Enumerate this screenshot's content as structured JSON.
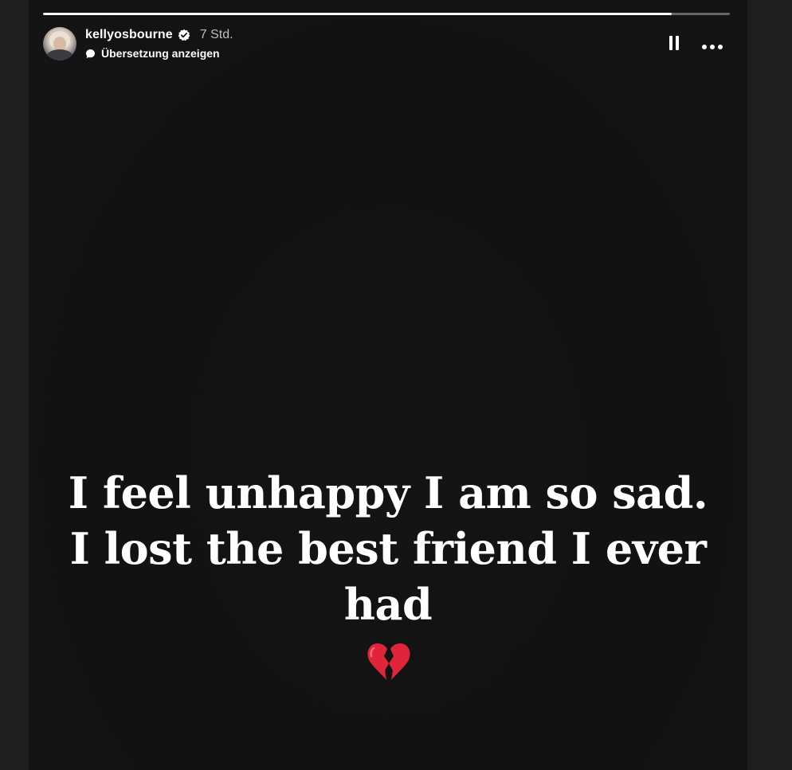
{
  "story": {
    "progress": 0.915,
    "username": "kellyosbourne",
    "verified": true,
    "time_ago": "7 Std.",
    "translate_label": "Übersetzung anzeigen",
    "message": "I feel unhappy I am so sad. I lost the best friend I ever had",
    "emoji": "broken-heart-emoji"
  },
  "icons": {
    "verified": "verified-badge-icon",
    "translate": "speech-bubble-icon",
    "pause": "pause-icon",
    "more": "more-options-icon"
  },
  "colors": {
    "background": "#121212",
    "text": "#ffffff",
    "verified": "#ffffff",
    "heart": "#e0253a"
  }
}
